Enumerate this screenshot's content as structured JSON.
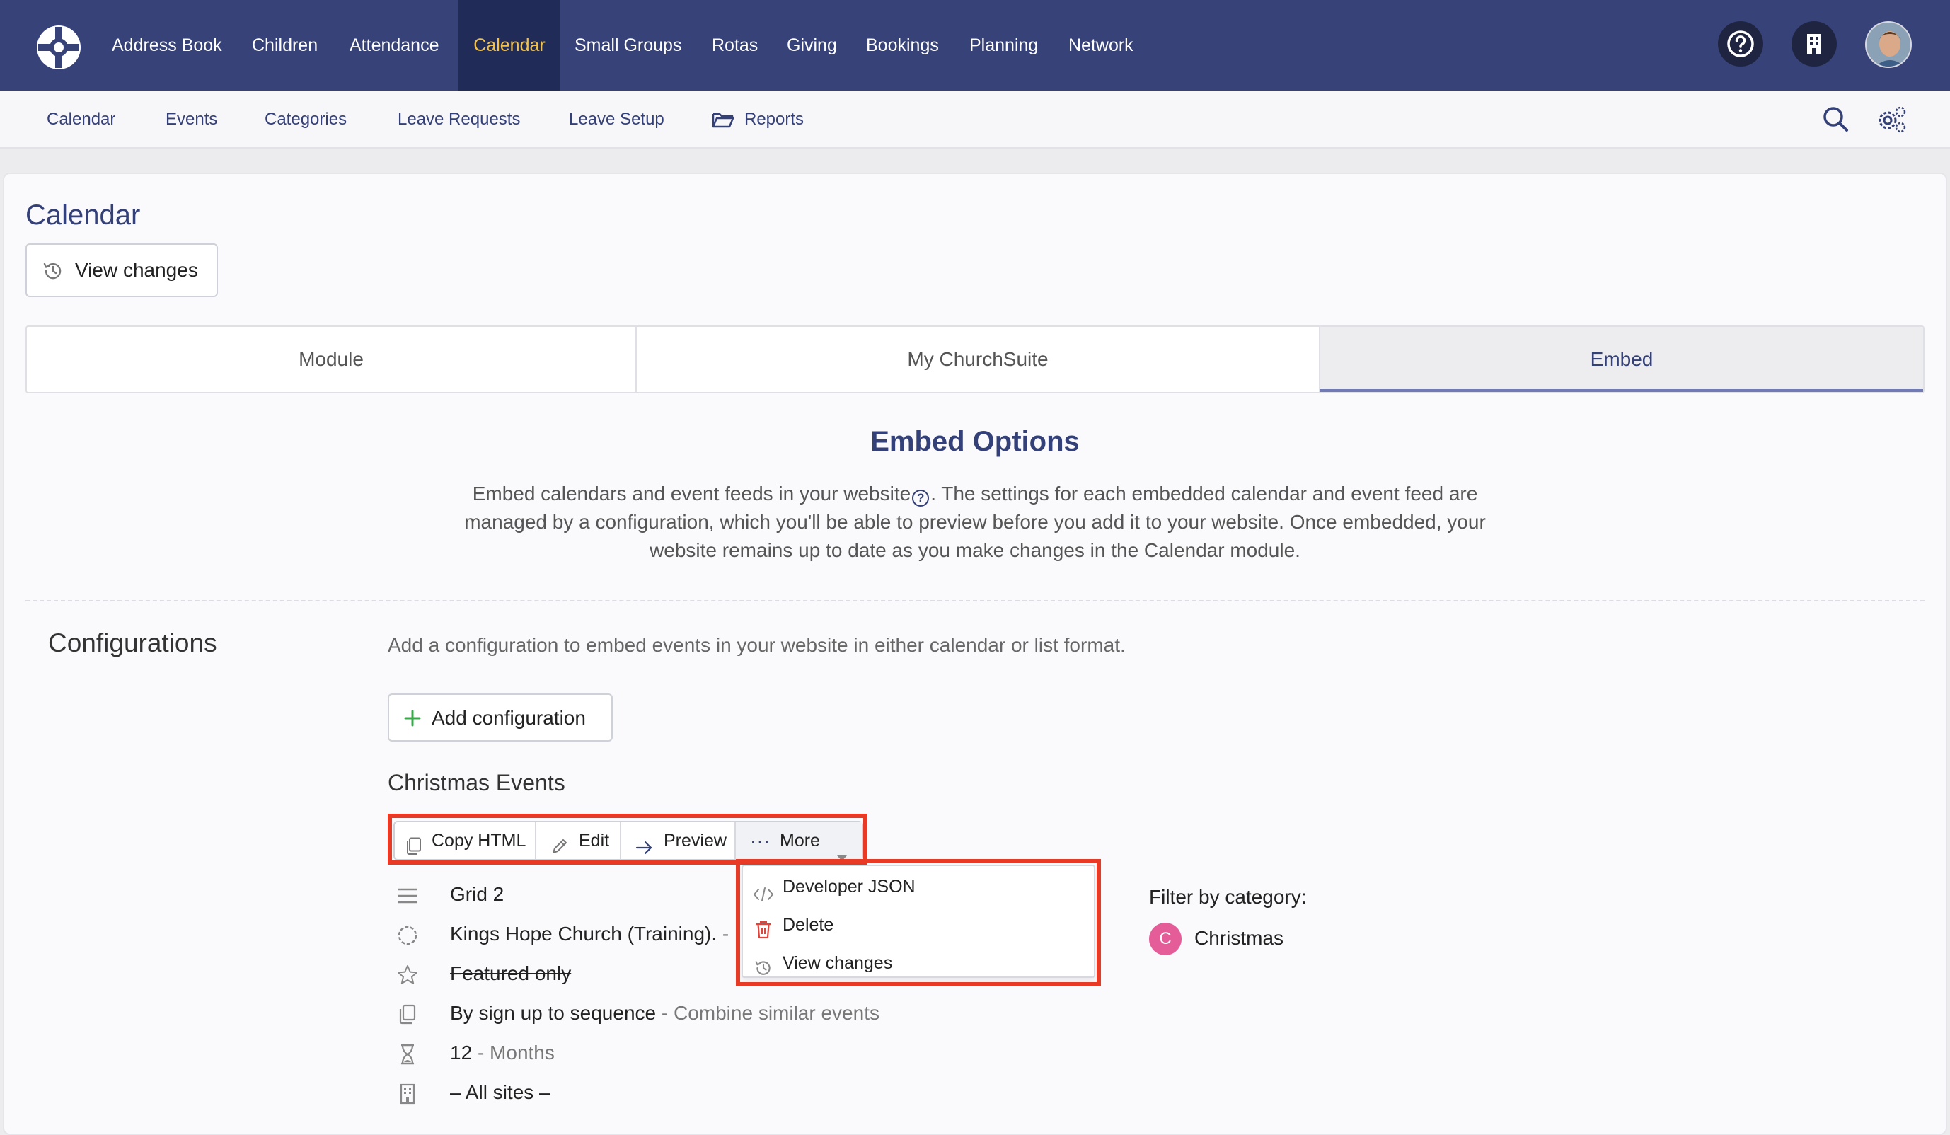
{
  "topnav": {
    "items": [
      "Address Book",
      "Children",
      "Attendance",
      "Calendar",
      "Small Groups",
      "Rotas",
      "Giving",
      "Bookings",
      "Planning",
      "Network"
    ],
    "active": "Calendar",
    "active_color": "#f2c24b",
    "icons": [
      "logo-icon",
      "help-icon",
      "building-icon",
      "avatar"
    ]
  },
  "subnav": {
    "items": [
      "Calendar",
      "Events",
      "Categories",
      "Leave Requests",
      "Leave Setup",
      "Reports"
    ],
    "icons": [
      "folder-icon",
      "search-icon",
      "settings-icon"
    ]
  },
  "page": {
    "title": "Calendar",
    "view_changes": "View changes"
  },
  "tabs": {
    "items": [
      "Module",
      "My ChurchSuite",
      "Embed"
    ],
    "selected": "Embed"
  },
  "embed": {
    "title": "Embed Options",
    "desc_line1_pre": "Embed calendars and event feeds in your website",
    "desc_line1_post": ". The settings for each embedded calendar and event feed are",
    "desc_line2": "managed by a configuration, which you'll be able to preview before you add it to your website. Once embedded, your",
    "desc_line3": "website remains up to date as you make changes in the Calendar module."
  },
  "configurations": {
    "heading": "Configurations",
    "description": "Add a configuration to embed events in your website in either calendar or list format.",
    "add_button": "Add configuration",
    "name": "Christmas Events",
    "actions": {
      "copy_html": "Copy HTML",
      "edit": "Edit",
      "preview": "Preview",
      "more": "More"
    },
    "more_menu": [
      "Developer JSON",
      "Delete",
      "View changes"
    ],
    "details": {
      "layout": "Grid 2",
      "site": "Kings Hope Church (Training).",
      "site_suffix": "-",
      "featured": "Featured only",
      "sequence": "By sign up to sequence",
      "sequence_note": "- Combine similar events",
      "duration_value": "12",
      "duration_unit": "- Months",
      "sites": "– All sites –"
    },
    "filter": {
      "label": "Filter by category:",
      "category_initial": "C",
      "category": "Christmas",
      "category_color": "#e45d99"
    }
  },
  "colors": {
    "topbar": "#364278",
    "active_tab_bg": "#212b58",
    "accent": "#344078",
    "highlight_red": "#e83a24",
    "delete_red": "#e0443a",
    "add_green": "#3aa94c"
  }
}
